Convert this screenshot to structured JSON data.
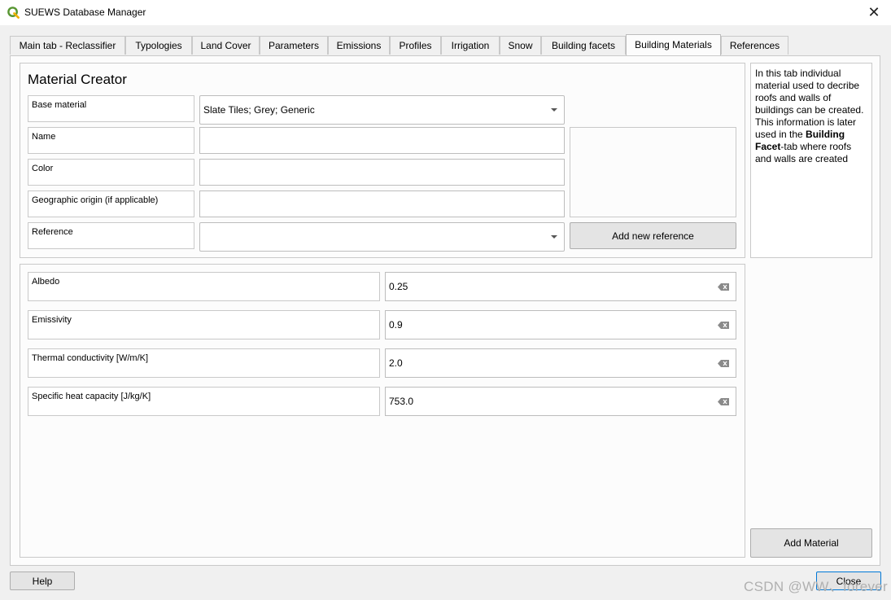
{
  "window": {
    "title": "SUEWS Database Manager"
  },
  "tabs": [
    {
      "label": "Main tab - Reclassifier",
      "active": false
    },
    {
      "label": "Typologies",
      "active": false
    },
    {
      "label": "Land Cover",
      "active": false
    },
    {
      "label": "Parameters",
      "active": false
    },
    {
      "label": "Emissions",
      "active": false
    },
    {
      "label": "Profiles",
      "active": false
    },
    {
      "label": "Irrigation",
      "active": false
    },
    {
      "label": "Snow",
      "active": false
    },
    {
      "label": "Building facets",
      "active": false
    },
    {
      "label": "Building Materials",
      "active": true
    },
    {
      "label": "References",
      "active": false
    }
  ],
  "creator": {
    "title": "Material Creator",
    "base_material_label": "Base material",
    "base_material_value": "Slate Tiles; Grey; Generic",
    "name_label": "Name",
    "name_value": "",
    "color_label": "Color",
    "color_value": "",
    "origin_label": "Geographic origin (if applicable)",
    "origin_value": "",
    "reference_label": "Reference",
    "reference_value": "",
    "add_reference_label": "Add new reference"
  },
  "params": {
    "albedo_label": "Albedo",
    "albedo_value": "0.25",
    "emissivity_label": "Emissivity",
    "emissivity_value": "0.9",
    "conductivity_label": "Thermal conductivity [W/m/K]",
    "conductivity_value": "2.0",
    "heat_capacity_label": "Specific heat capacity [J/kg/K]",
    "heat_capacity_value": "753.0"
  },
  "info": {
    "text_before": "In this tab individual material used to decribe roofs and walls of buildings can be created. This information is later used in the ",
    "text_bold": "Building Facet",
    "text_after": "-tab where roofs and walls are created"
  },
  "buttons": {
    "add_material": "Add Material",
    "help": "Help",
    "close": "Close"
  },
  "watermark": "CSDN @WW、forever",
  "colors": {
    "app_icon_green": "#589632",
    "app_icon_yellow": "#f0b000"
  }
}
